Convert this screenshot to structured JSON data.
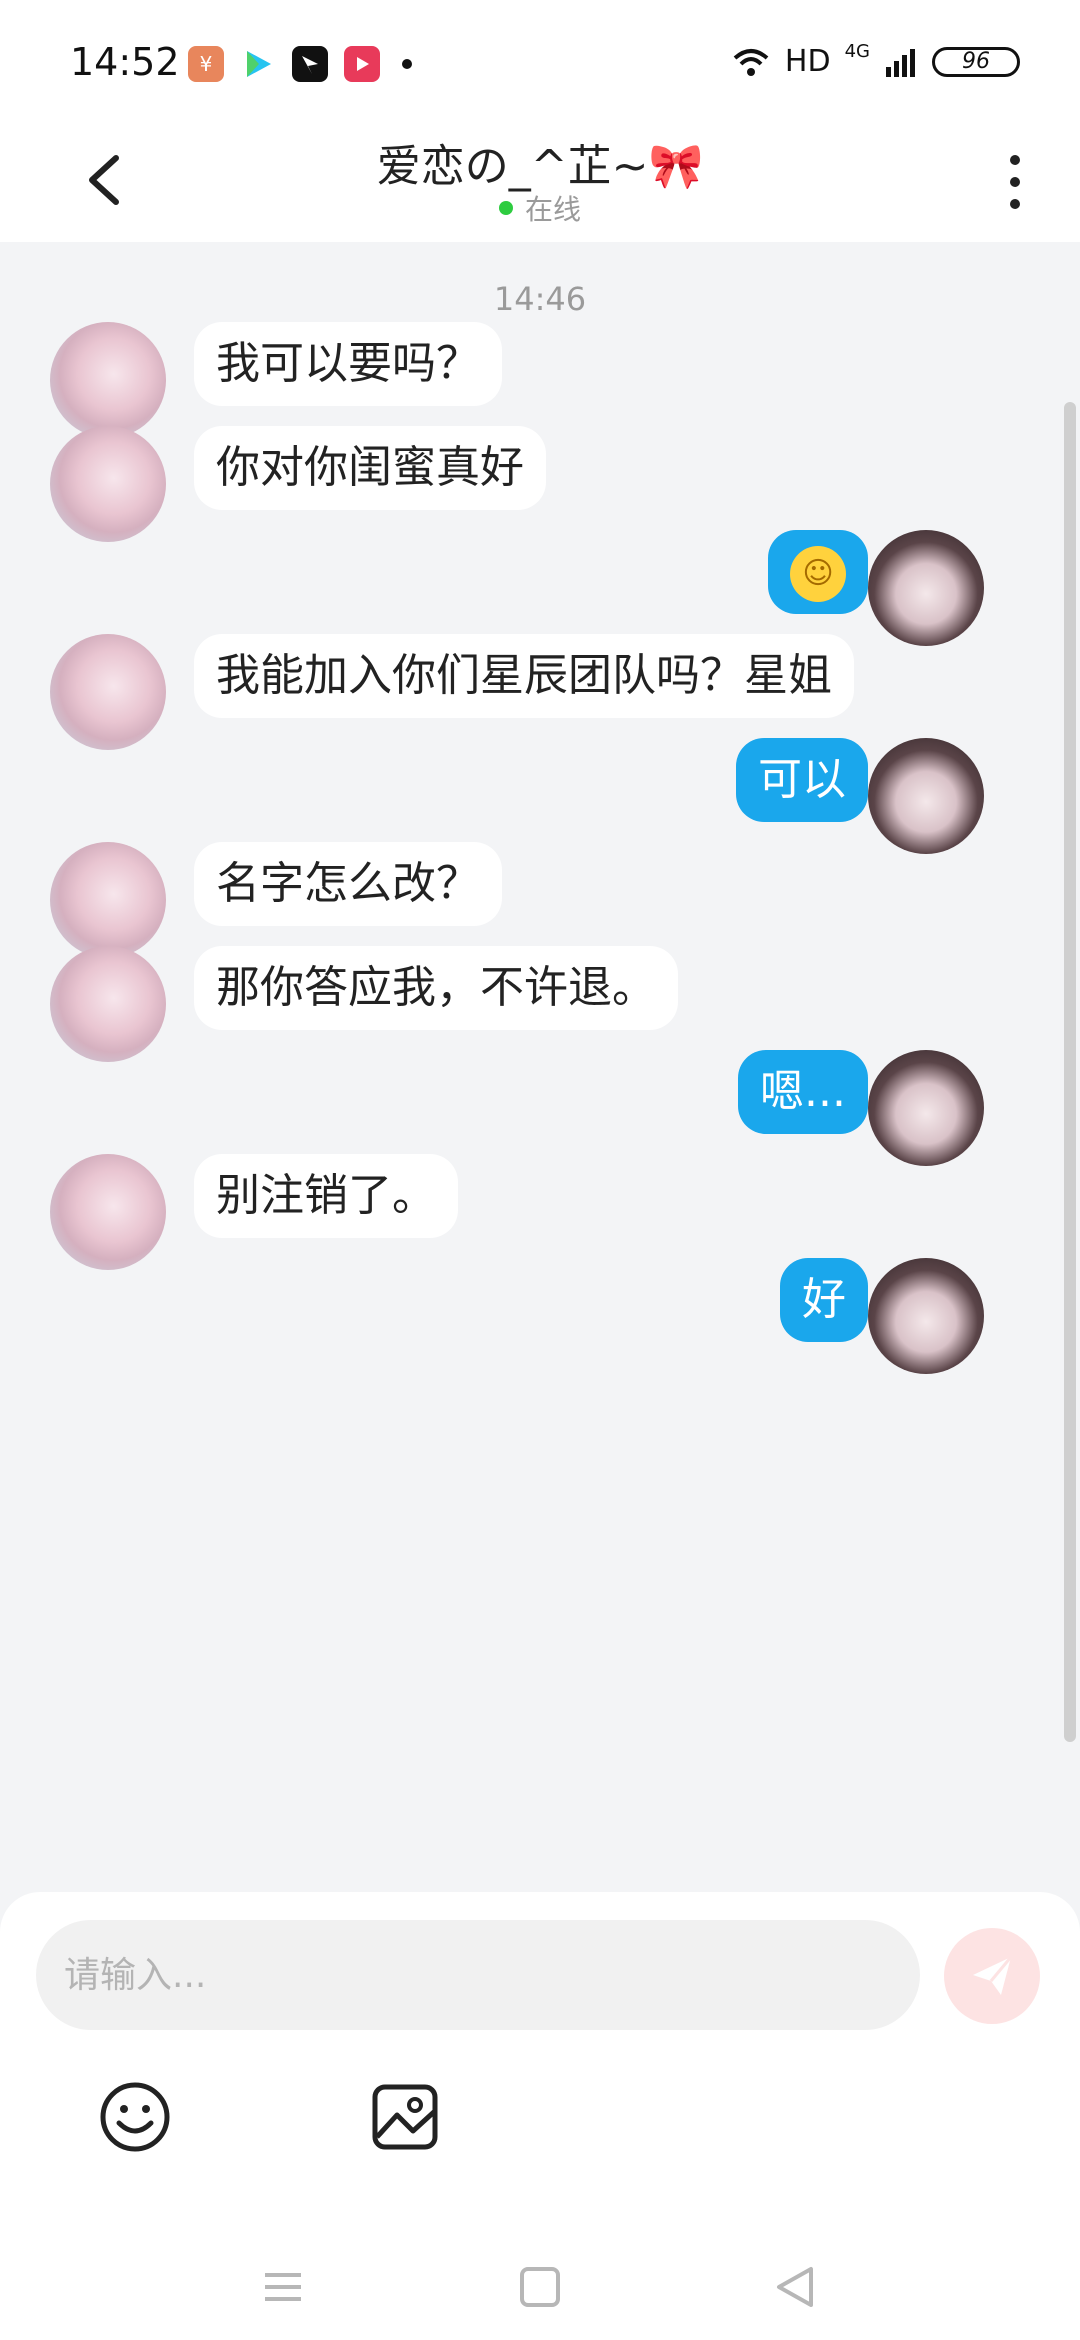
{
  "status_bar": {
    "time": "14:52",
    "network": "HD",
    "signal": "4G",
    "battery": "96"
  },
  "header": {
    "title": "爱恋の_^芷~🎀",
    "status": "在线"
  },
  "chat": {
    "timestamp": "14:46",
    "messages": [
      {
        "side": "left",
        "text": "我可以要吗？"
      },
      {
        "side": "left",
        "text": "你对你闺蜜真好"
      },
      {
        "side": "right",
        "text": "",
        "emoji": "☺"
      },
      {
        "side": "left",
        "text": "我能加入你们星辰团队吗？星姐"
      },
      {
        "side": "right",
        "text": "可以"
      },
      {
        "side": "left",
        "text": "名字怎么改？"
      },
      {
        "side": "left",
        "text": "那你答应我，不许退。"
      },
      {
        "side": "right",
        "text": "嗯..."
      },
      {
        "side": "left",
        "text": "别注销了。"
      },
      {
        "side": "right",
        "text": "好"
      }
    ]
  },
  "composer": {
    "placeholder": "请输入..."
  },
  "colors": {
    "accent": "#1aa7ec",
    "background": "#f3f4f6",
    "online": "#2ecc40"
  }
}
